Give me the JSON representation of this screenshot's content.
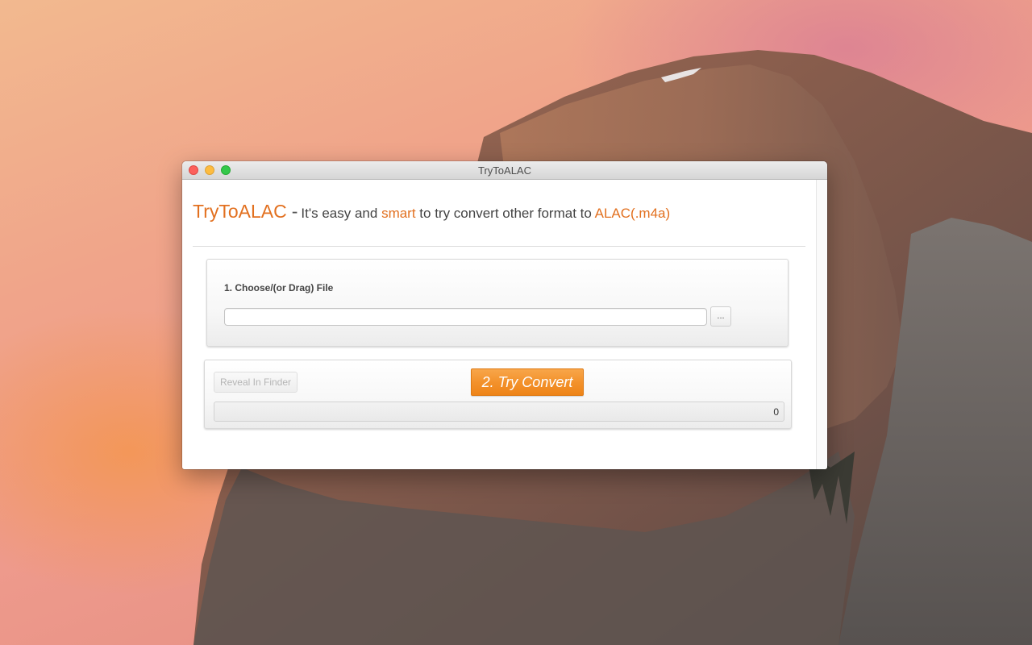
{
  "window": {
    "title": "TryToALAC"
  },
  "header": {
    "brand": "TryToALAC",
    "dash": "-",
    "text1": "It's easy and",
    "accent1": "smart",
    "text2": "to try convert other format to",
    "accent2": "ALAC(.m4a)"
  },
  "step1": {
    "label": "1. Choose/(or Drag) File",
    "file_value": "",
    "file_placeholder": "",
    "browse_label": "..."
  },
  "step2": {
    "reveal_label": "Reveal In Finder",
    "reveal_enabled": false,
    "convert_label": "2. Try Convert",
    "progress_fraction": 0,
    "progress_count": "0"
  },
  "colors": {
    "accent": "#e2701f",
    "button_orange": "#f3922c",
    "close": "#fc605c",
    "minimize": "#fdbc40",
    "zoom": "#34c84a"
  },
  "icons": {
    "close": "close-dot-icon",
    "minimize": "minimize-dot-icon",
    "zoom": "zoom-dot-icon"
  }
}
